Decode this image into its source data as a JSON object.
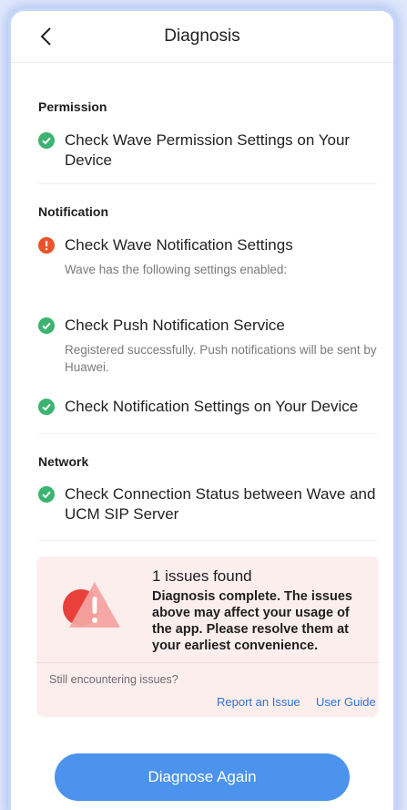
{
  "header": {
    "title": "Diagnosis",
    "back_icon": "chevron-left-icon"
  },
  "sections": {
    "permission": {
      "title": "Permission",
      "items": [
        {
          "title": "Check Wave Permission Settings on Your Device",
          "status": "ok"
        }
      ]
    },
    "notification": {
      "title": "Notification",
      "items": [
        {
          "title": "Check Wave Notification Settings",
          "status": "error",
          "description": "Wave has the following settings enabled:"
        },
        {
          "title": "Check Push Notification Service",
          "status": "ok",
          "description": "Registered successfully. Push notifications will be sent by Huawei."
        },
        {
          "title": "Check Notification Settings on Your Device",
          "status": "ok"
        }
      ]
    },
    "network": {
      "title": "Network",
      "items": [
        {
          "title": "Check Connection Status between Wave and UCM SIP Server",
          "status": "ok"
        }
      ]
    }
  },
  "alert": {
    "count_text": "1 issues found",
    "message": "Diagnosis complete. The issues above may affect your usage of the app. Please resolve them at your earliest convenience.",
    "still_text": "Still encountering issues?",
    "report_link": "Report an Issue",
    "guide_link": "User Guide"
  },
  "actions": {
    "diagnose_again": "Diagnose Again"
  },
  "colors": {
    "ok": "#3cb371",
    "error": "#e8532a",
    "primary_button": "#4b93ec",
    "alert_background": "#fdeeee",
    "link": "#2d72d9"
  }
}
